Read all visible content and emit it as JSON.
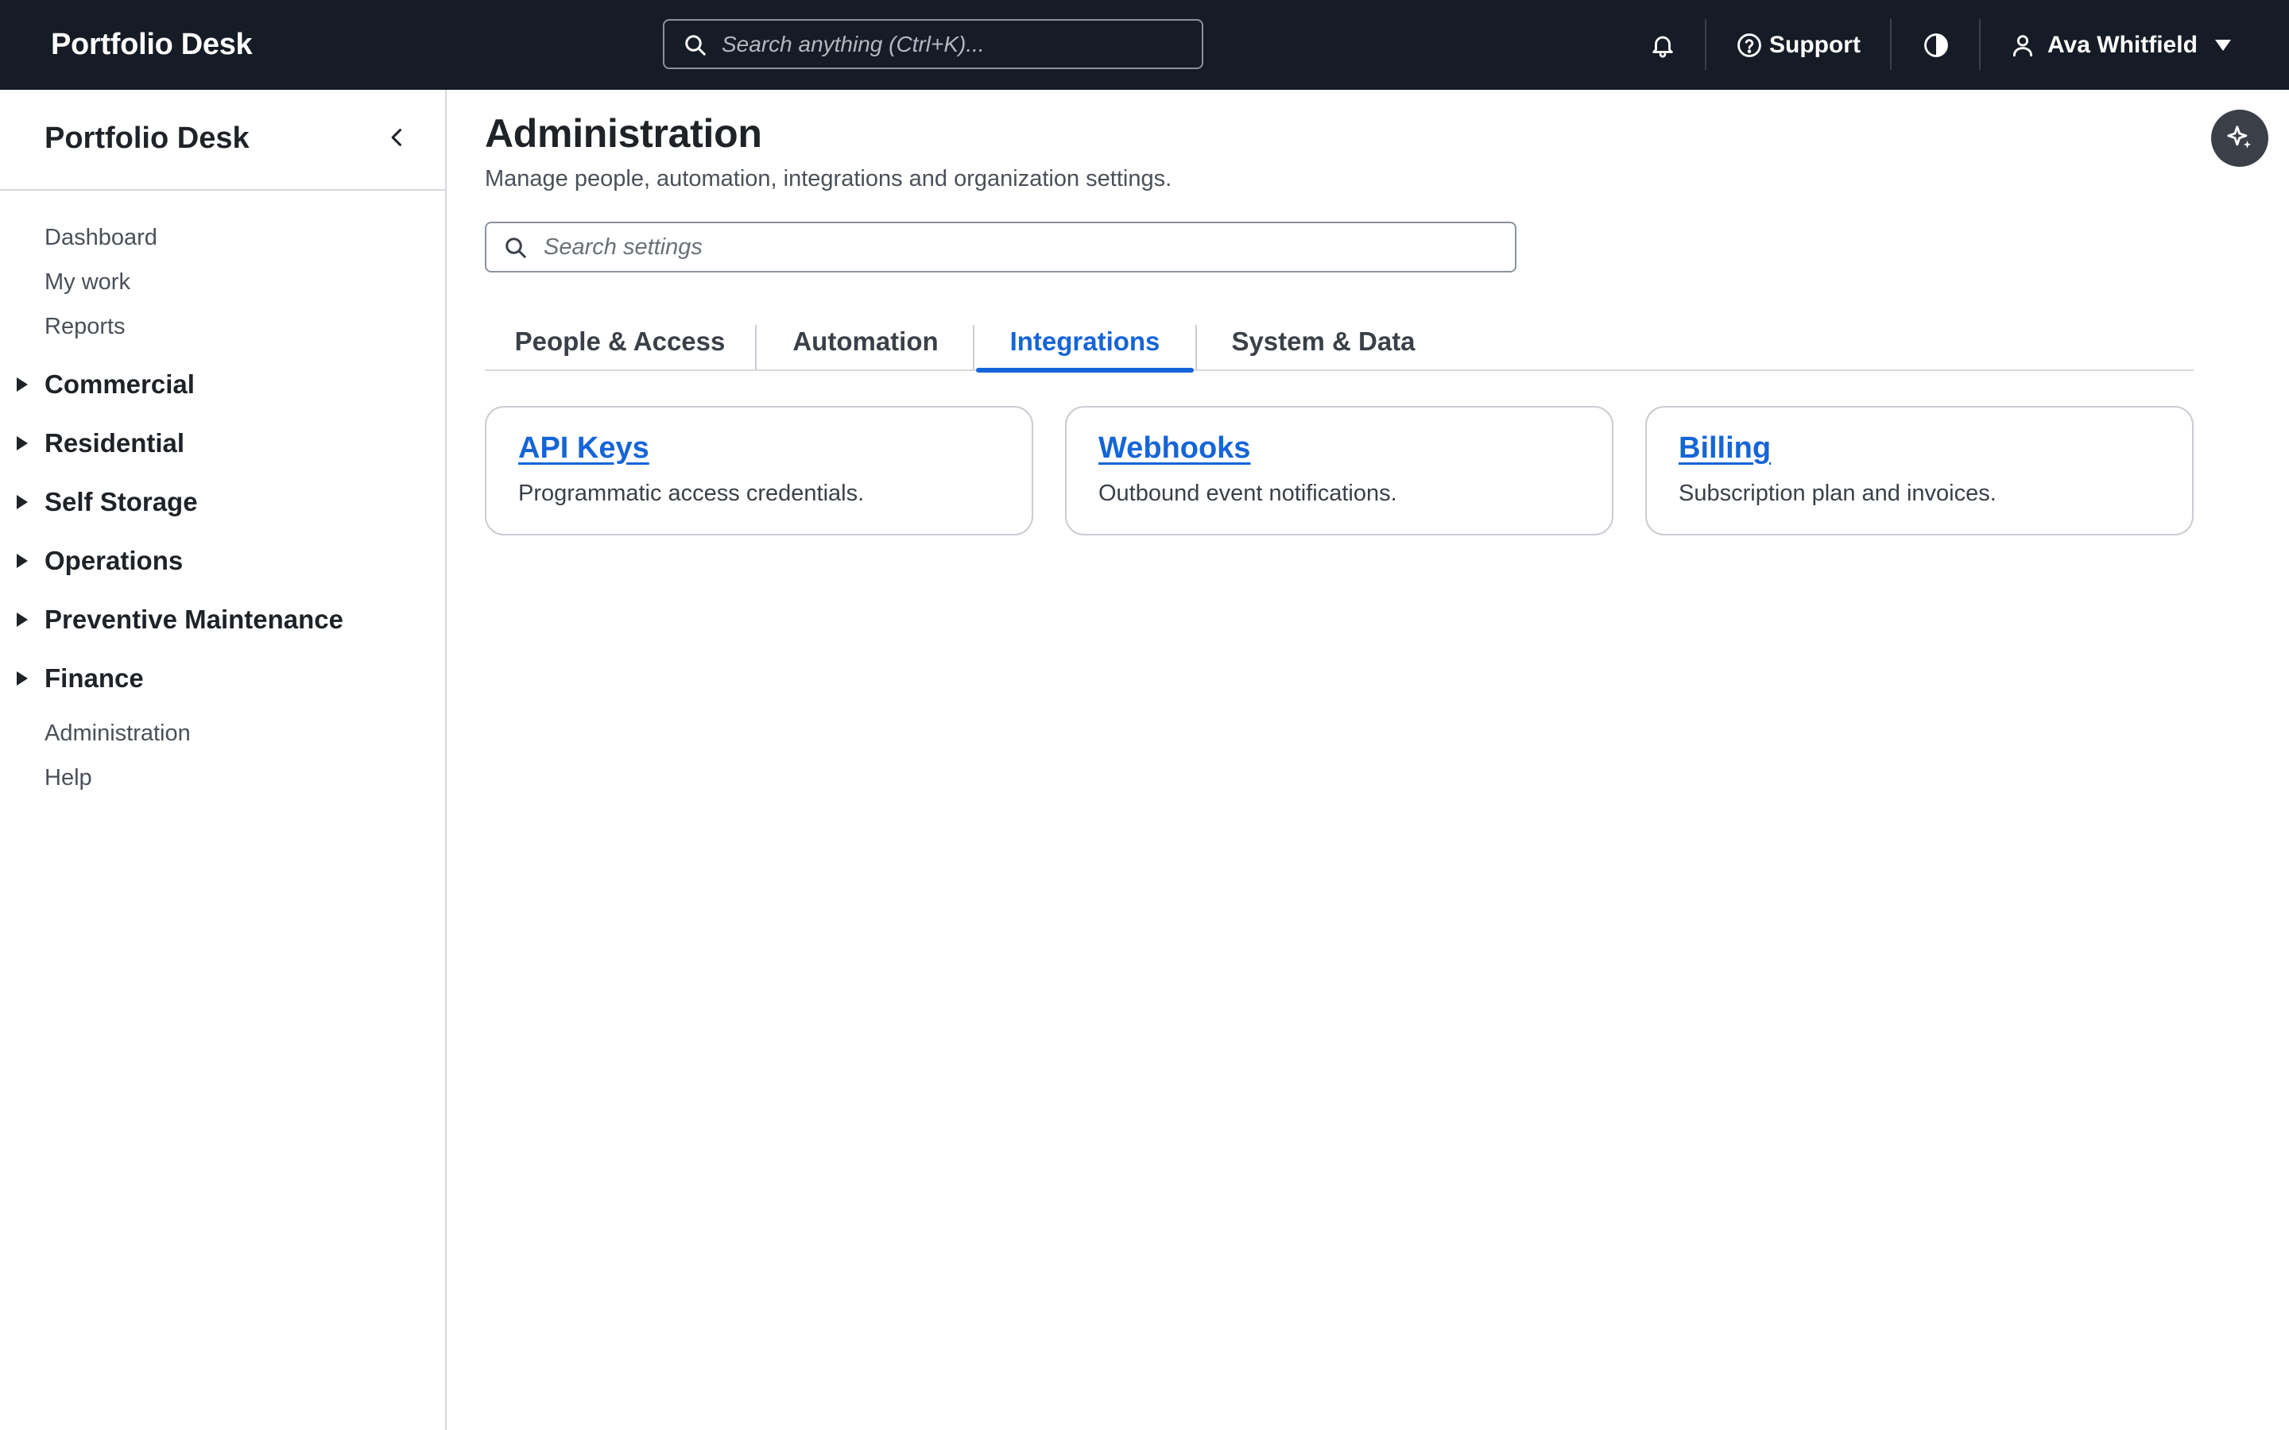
{
  "topbar": {
    "brand": "Portfolio Desk",
    "search_placeholder": "Search anything (Ctrl+K)...",
    "support_label": "Support",
    "user_name": "Ava Whitfield",
    "icons": [
      "search-icon",
      "bell-icon",
      "help-circle-icon",
      "contrast-icon",
      "user-icon",
      "caret-down-icon"
    ]
  },
  "sidebar": {
    "title": "Portfolio Desk",
    "top_links": [
      "Dashboard",
      "My work",
      "Reports"
    ],
    "groups": [
      "Commercial",
      "Residential",
      "Self Storage",
      "Operations",
      "Preventive Maintenance",
      "Finance"
    ],
    "bottom_links": [
      "Administration",
      "Help"
    ]
  },
  "main": {
    "title": "Administration",
    "subtitle": "Manage people, automation, integrations and organization settings.",
    "search_placeholder": "Search settings",
    "tabs": [
      {
        "label": "People & Access",
        "active": false
      },
      {
        "label": "Automation",
        "active": false
      },
      {
        "label": "Integrations",
        "active": true
      },
      {
        "label": "System & Data",
        "active": false
      }
    ],
    "cards": [
      {
        "title": "API Keys",
        "description": "Programmatic access credentials."
      },
      {
        "title": "Webhooks",
        "description": "Outbound event notifications."
      },
      {
        "title": "Billing",
        "description": "Subscription plan and invoices."
      }
    ]
  },
  "colors": {
    "topbar_bg": "#161c26",
    "accent": "#1565d8",
    "text": "#1f2328",
    "muted": "#4b5058",
    "border": "#d6d9de"
  }
}
